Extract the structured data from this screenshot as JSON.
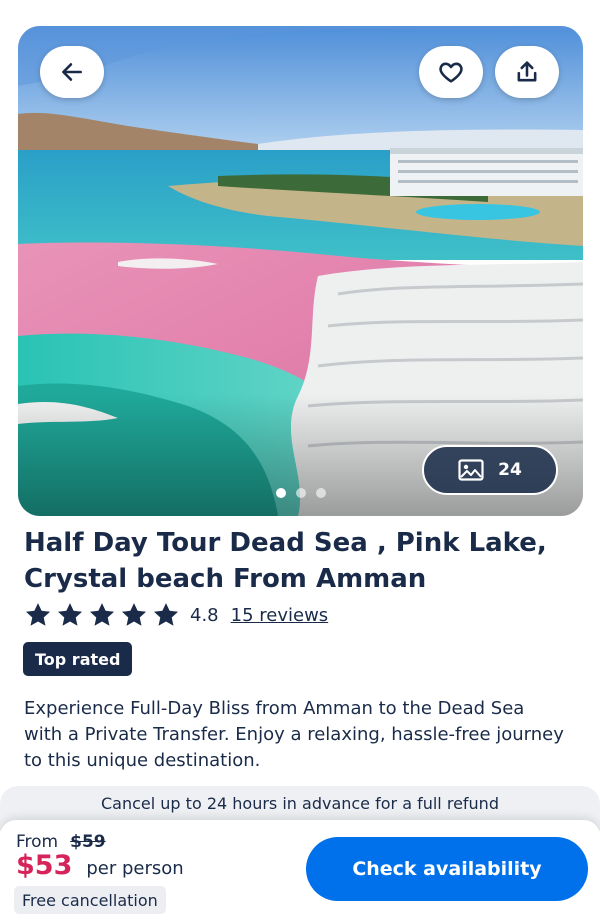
{
  "hero": {
    "photo_count": "24",
    "carousel": {
      "total": 3,
      "active_index": 0
    },
    "icons": {
      "back": "arrow-left-icon",
      "favorite": "heart-icon",
      "share": "share-icon",
      "gallery": "image-icon"
    }
  },
  "tour": {
    "title": "Half Day Tour Dead Sea , Pink Lake, Crystal beach From Amman",
    "rating": "4.8",
    "rating_stars": 5,
    "reviews_label": "15 reviews",
    "badge": "Top rated",
    "description": "Experience Full-Day Bliss from Amman to the Dead Sea with a Private Transfer. Enjoy a relaxing, hassle-free journey to this unique destination."
  },
  "cancellation_banner": "Cancel up to 24 hours in advance for a full refund",
  "booking": {
    "from_label": "From",
    "old_price": "$59",
    "price": "$53",
    "per_person": "per person",
    "free_cancellation": "Free cancellation",
    "cta_label": "Check availability"
  },
  "colors": {
    "navy": "#1a2b49",
    "price_red": "#d6245b",
    "cta_blue": "#0071eb"
  }
}
